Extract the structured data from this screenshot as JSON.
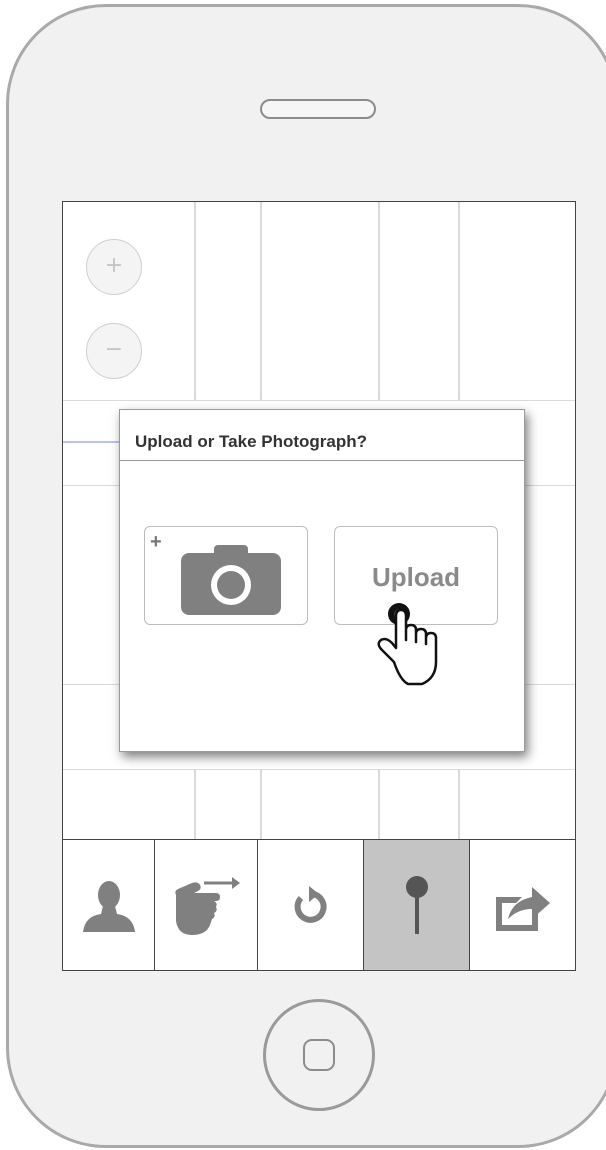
{
  "dialog": {
    "title": "Upload or Take Photograph?",
    "take_photo": {
      "plus_label": "+",
      "icon": "camera-icon"
    },
    "upload_label": "Upload"
  },
  "map": {
    "zoom_in_label": "+",
    "zoom_out_label": "−"
  },
  "toolbar": {
    "items": [
      {
        "name": "profile",
        "icon": "person-icon",
        "active": false
      },
      {
        "name": "swipe",
        "icon": "swipe-hand-icon",
        "active": false
      },
      {
        "name": "refresh",
        "icon": "refresh-icon",
        "active": false
      },
      {
        "name": "pin",
        "icon": "map-pin-icon",
        "active": true
      },
      {
        "name": "share",
        "icon": "share-icon",
        "active": false
      }
    ]
  },
  "colors": {
    "phone_body": "#f1f1f1",
    "icon_gray": "#808080",
    "active_tab": "#c4c4c4",
    "road": "#b8c3f0"
  }
}
